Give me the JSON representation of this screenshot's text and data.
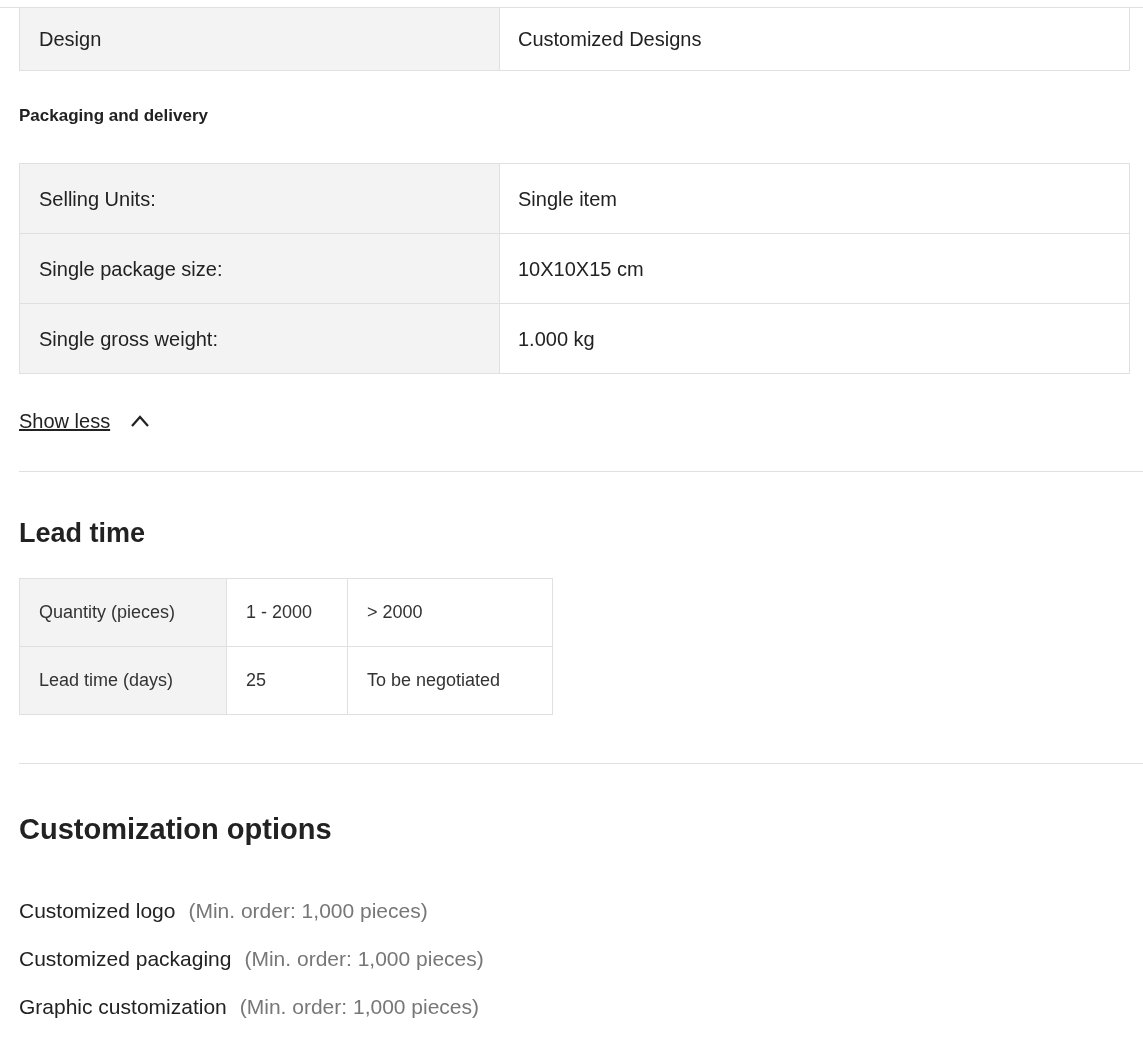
{
  "design_table": {
    "rows": [
      {
        "label": "Design",
        "value": "Customized Designs"
      }
    ]
  },
  "packaging": {
    "title": "Packaging and delivery",
    "rows": [
      {
        "label": "Selling Units:",
        "value": "Single item"
      },
      {
        "label": "Single package size:",
        "value": "10X10X15 cm"
      },
      {
        "label": "Single gross weight:",
        "value": "1.000 kg"
      }
    ]
  },
  "show_less": {
    "label": "Show less"
  },
  "lead_time": {
    "title": "Lead time",
    "rows": [
      [
        "Quantity (pieces)",
        "1 - 2000",
        "> 2000"
      ],
      [
        "Lead time (days)",
        "25",
        "To be negotiated"
      ]
    ]
  },
  "customization": {
    "title": "Customization options",
    "options": [
      {
        "name": "Customized logo",
        "note": "(Min. order: 1,000 pieces)"
      },
      {
        "name": "Customized packaging",
        "note": "(Min. order: 1,000 pieces)"
      },
      {
        "name": "Graphic customization",
        "note": "(Min. order: 1,000 pieces)"
      }
    ]
  }
}
